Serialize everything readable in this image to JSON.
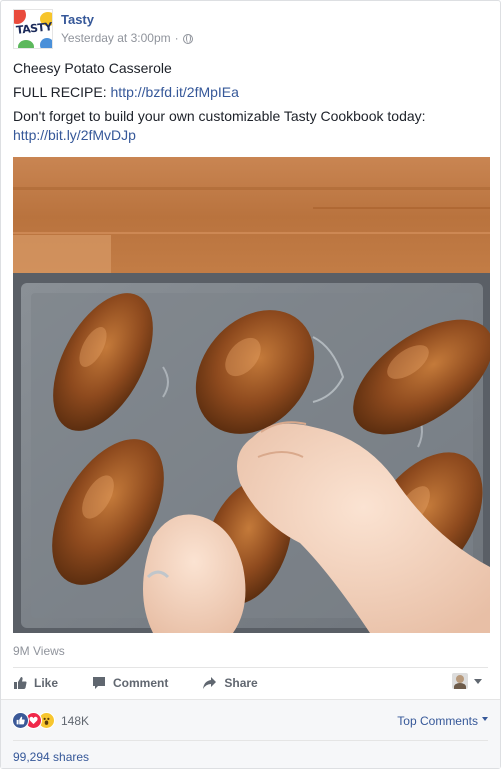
{
  "post": {
    "page_name": "Tasty",
    "avatar_text": "TASTY",
    "timestamp": "Yesterday at 3:00pm",
    "separator": "·",
    "privacy_icon": "globe-icon",
    "title": "Cheesy Potato Casserole",
    "recipe_label": "FULL RECIPE: ",
    "recipe_link": "http://bzfd.it/2fMpIEa",
    "cookbook_text": "Don't forget to build your own customizable Tasty Cookbook today:",
    "cookbook_link": "http://bit.ly/2fMvDJp"
  },
  "video": {
    "views": "9M Views"
  },
  "actions": {
    "like": "Like",
    "comment": "Comment",
    "share": "Share"
  },
  "footer": {
    "reaction_icons": [
      "like-reaction-icon",
      "love-reaction-icon",
      "wow-reaction-icon"
    ],
    "reaction_count": "148K",
    "top_comments": "Top Comments",
    "shares": "99,294 shares"
  },
  "colors": {
    "link": "#365899",
    "meta": "#90949c",
    "like_reaction": "#3b5998",
    "love_reaction": "#f0284a",
    "wow_reaction": "#f7c62f"
  }
}
